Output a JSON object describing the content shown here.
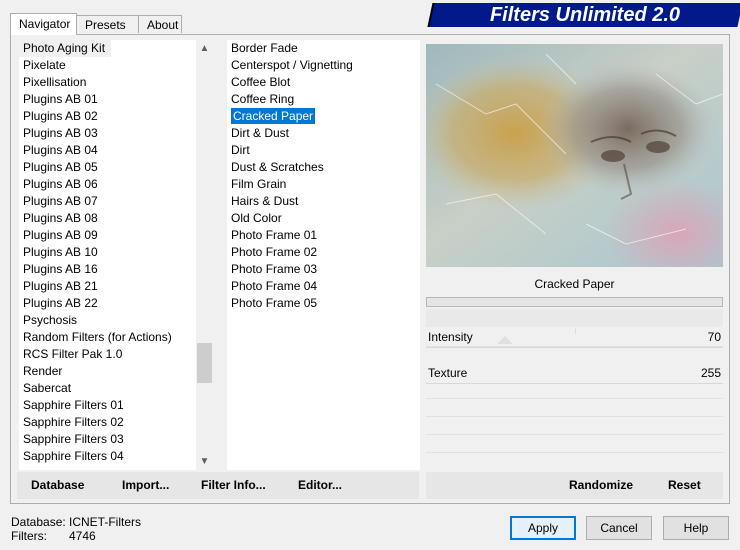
{
  "tabs": [
    {
      "label": "Navigator",
      "active": true
    },
    {
      "label": "Presets",
      "active": false
    },
    {
      "label": "About",
      "active": false
    }
  ],
  "app_title": "Filters Unlimited 2.0",
  "categories": {
    "items": [
      "Photo Aging Kit",
      "Pixelate",
      "Pixellisation",
      "Plugins AB 01",
      "Plugins AB 02",
      "Plugins AB 03",
      "Plugins AB 04",
      "Plugins AB 05",
      "Plugins AB 06",
      "Plugins AB 07",
      "Plugins AB 08",
      "Plugins AB 09",
      "Plugins AB 10",
      "Plugins AB 16",
      "Plugins AB 21",
      "Plugins AB 22",
      "Psychosis",
      "Random Filters (for Actions)",
      "RCS Filter Pak 1.0",
      "Render",
      "Sabercat",
      "Sapphire Filters 01",
      "Sapphire Filters 02",
      "Sapphire Filters 03",
      "Sapphire Filters 04"
    ],
    "selected": "Photo Aging Kit"
  },
  "filters": {
    "items": [
      "Border Fade",
      "Centerspot / Vignetting",
      "Coffee Blot",
      "Coffee Ring",
      "Cracked Paper",
      "Dirt & Dust",
      "Dirt",
      "Dust & Scratches",
      "Film Grain",
      "Hairs & Dust",
      "Old Color",
      "Photo Frame 01",
      "Photo Frame 02",
      "Photo Frame 03",
      "Photo Frame 04",
      "Photo Frame 05"
    ],
    "selected": "Cracked Paper"
  },
  "preview": {
    "filter_name": "Cracked Paper",
    "params": [
      {
        "label": "Intensity",
        "value": "70"
      },
      {
        "label": "Texture",
        "value": "255"
      }
    ]
  },
  "left_buttons": [
    "Database",
    "Import...",
    "Filter Info...",
    "Editor..."
  ],
  "right_buttons": [
    "Randomize",
    "Reset"
  ],
  "status": {
    "database_label": "Database:",
    "database_value": "ICNET-Filters",
    "filters_label": "Filters:",
    "filters_value": "4746"
  },
  "dialog_buttons": {
    "apply": "Apply",
    "cancel": "Cancel",
    "help": "Help"
  },
  "colors": {
    "banner": "#001a8a",
    "selection": "#0078d7"
  }
}
